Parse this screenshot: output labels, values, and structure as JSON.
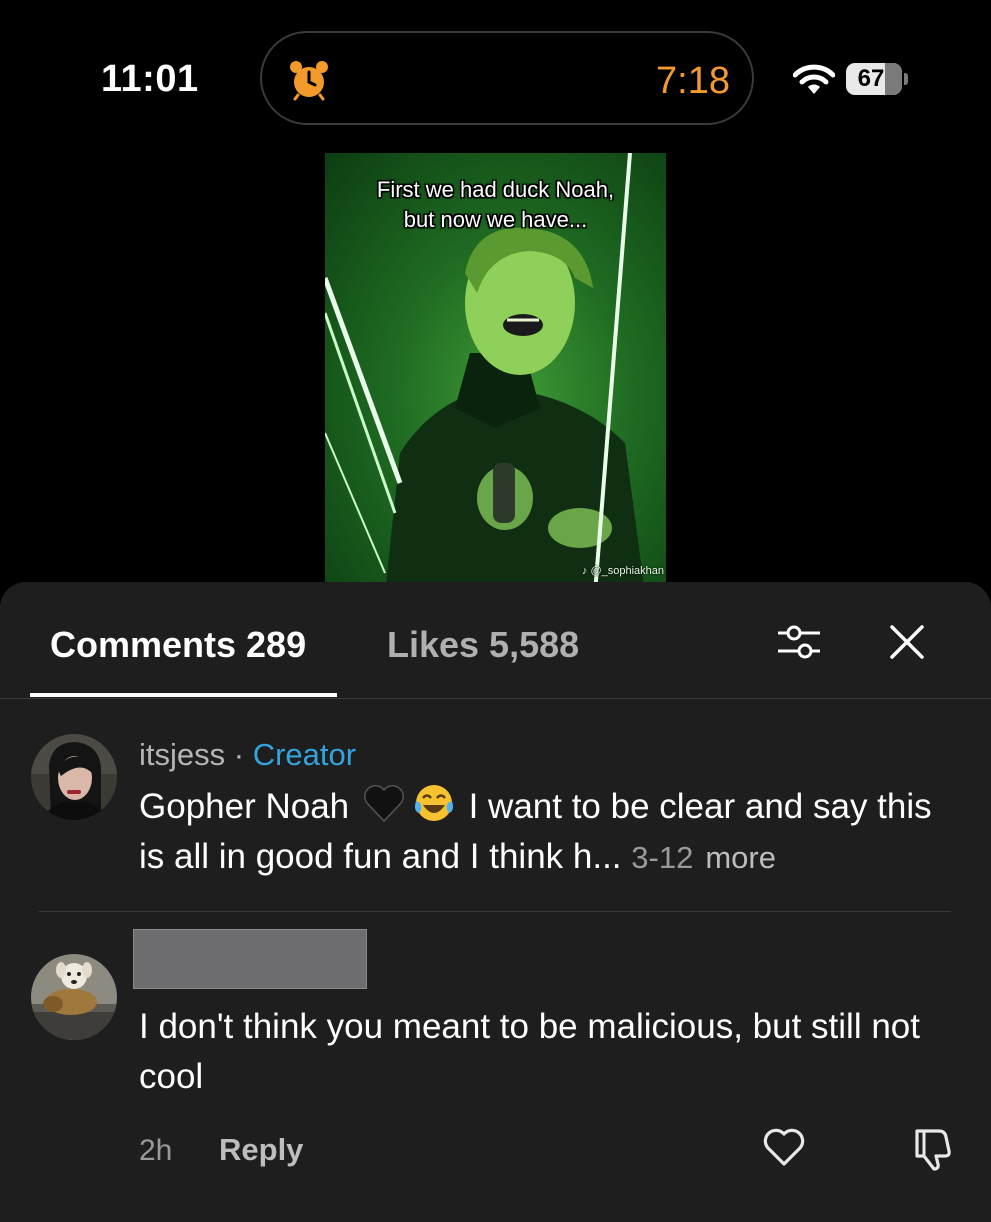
{
  "status_bar": {
    "time": "11:01",
    "timer": "7:18",
    "battery": "67",
    "icons": [
      "alarm-icon",
      "wifi-icon",
      "battery-icon"
    ]
  },
  "video": {
    "caption_line1": "First we had duck Noah,",
    "caption_line2": "but now we have...",
    "watermark": "@_sophiakhan"
  },
  "comments_panel": {
    "tabs": [
      {
        "label": "Comments 289",
        "active": true
      },
      {
        "label": "Likes 5,588",
        "active": false
      }
    ],
    "icons": [
      "filter-sliders-icon",
      "close-icon"
    ],
    "comments": [
      {
        "username": "itsjess",
        "separator": "·",
        "badge": "Creator",
        "text_part1": "Gopher Noah",
        "emojis": [
          "black-heart-emoji",
          "tears-of-joy-emoji"
        ],
        "text_part2": " I want to be clear and say this is all in good fun and I think h...",
        "date": "3-12",
        "more_label": "more"
      },
      {
        "username_redacted": true,
        "text": "I don't think you meant to be malicious, but still not cool",
        "time_ago": "2h",
        "reply_label": "Reply",
        "icons": [
          "heart-icon",
          "dislike-icon"
        ]
      }
    ]
  },
  "colors": {
    "background": "#000000",
    "sheet": "#1e1e1e",
    "creator_badge": "#33a3dc",
    "timer": "#f39a2c",
    "video_green": "#2f8a2a"
  }
}
